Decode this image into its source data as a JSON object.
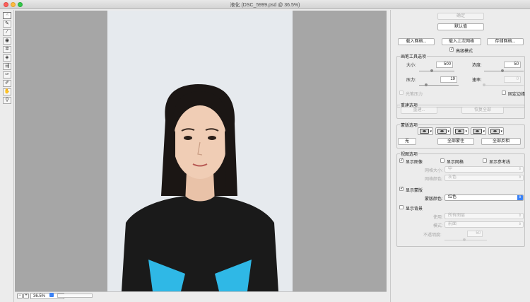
{
  "window": {
    "title": "液化 (DSC_5999.psd @ 36.5%)"
  },
  "status": {
    "zoom": "36.5%"
  },
  "top_buttons": {
    "ok": "确定",
    "defaults": "默认值"
  },
  "mesh_buttons": {
    "load": "载入网格...",
    "load_last": "载入上次网格",
    "save": "存储网格..."
  },
  "advanced": {
    "label": "高级模式",
    "checked": true
  },
  "brush": {
    "title": "画笔工具选项",
    "size_label": "大小:",
    "size": "500",
    "density_label": "浓度:",
    "density": "50",
    "pressure_label": "压力:",
    "pressure": "19",
    "rate_label": "速率:",
    "rate": "0",
    "stylus_label": "光笔压力",
    "pin_label": "固定边缘"
  },
  "reconstruct": {
    "title": "重建选项",
    "rebuild": "重建...",
    "restore": "恢复全部"
  },
  "mask": {
    "title": "蒙版选项",
    "none": "无",
    "mask_all": "全部蒙住",
    "invert_all": "全部反相"
  },
  "view": {
    "title": "视图选项",
    "show_image": "显示图像",
    "show_mesh": "显示网格",
    "show_guides": "显示参考线",
    "mesh_size_label": "网格大小:",
    "mesh_size": "中",
    "mesh_color_label": "网格颜色:",
    "mesh_color": "灰色",
    "show_mask": "显示蒙版",
    "mask_color_label": "蒙版颜色:",
    "mask_color": "红色",
    "show_backdrop": "显示背景",
    "use_label": "使用:",
    "use": "所有图层",
    "mode_label": "模式:",
    "mode": "前面",
    "opacity_label": "不透明度:",
    "opacity": "50"
  },
  "colors": {
    "accent": "#3b82f6",
    "shirt": "#1a1a1a",
    "eyes_print": "#2fb8e6"
  }
}
